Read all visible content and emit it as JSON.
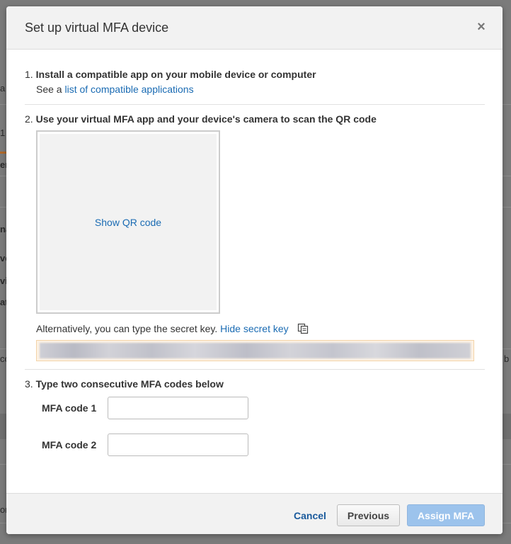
{
  "background": {
    "fragments": [
      "a",
      "1",
      "er",
      "na",
      "vo",
      "vi",
      "at",
      "co",
      "b",
      "on"
    ]
  },
  "modal": {
    "title": "Set up virtual MFA device",
    "close_symbol": "×",
    "close_icon": "close-icon"
  },
  "step1": {
    "number": "1.",
    "title": "Install a compatible app on your mobile device or computer",
    "sub_prefix": "See a",
    "sub_link": "list of compatible applications"
  },
  "step2": {
    "number": "2.",
    "title": "Use your virtual MFA app and your device's camera to scan the QR code",
    "qr_link": "Show QR code",
    "alt_text": "Alternatively, you can type the secret key.",
    "alt_link": "Hide secret key",
    "copy_icon": "copy-icon",
    "secret_key": "••••••••••••••••••••••••••••••••••••••••••••••••••••••••••••••••"
  },
  "step3": {
    "number": "3.",
    "title": "Type two consecutive MFA codes below",
    "code1_label": "MFA code 1",
    "code1_value": "",
    "code2_label": "MFA code 2",
    "code2_value": ""
  },
  "footer": {
    "cancel_label": "Cancel",
    "previous_label": "Previous",
    "assign_label": "Assign MFA"
  },
  "colors": {
    "link": "#1a6bb3",
    "assign_button_disabled": "#9cc3ec",
    "secret_field_bg": "#fdf2e4"
  }
}
